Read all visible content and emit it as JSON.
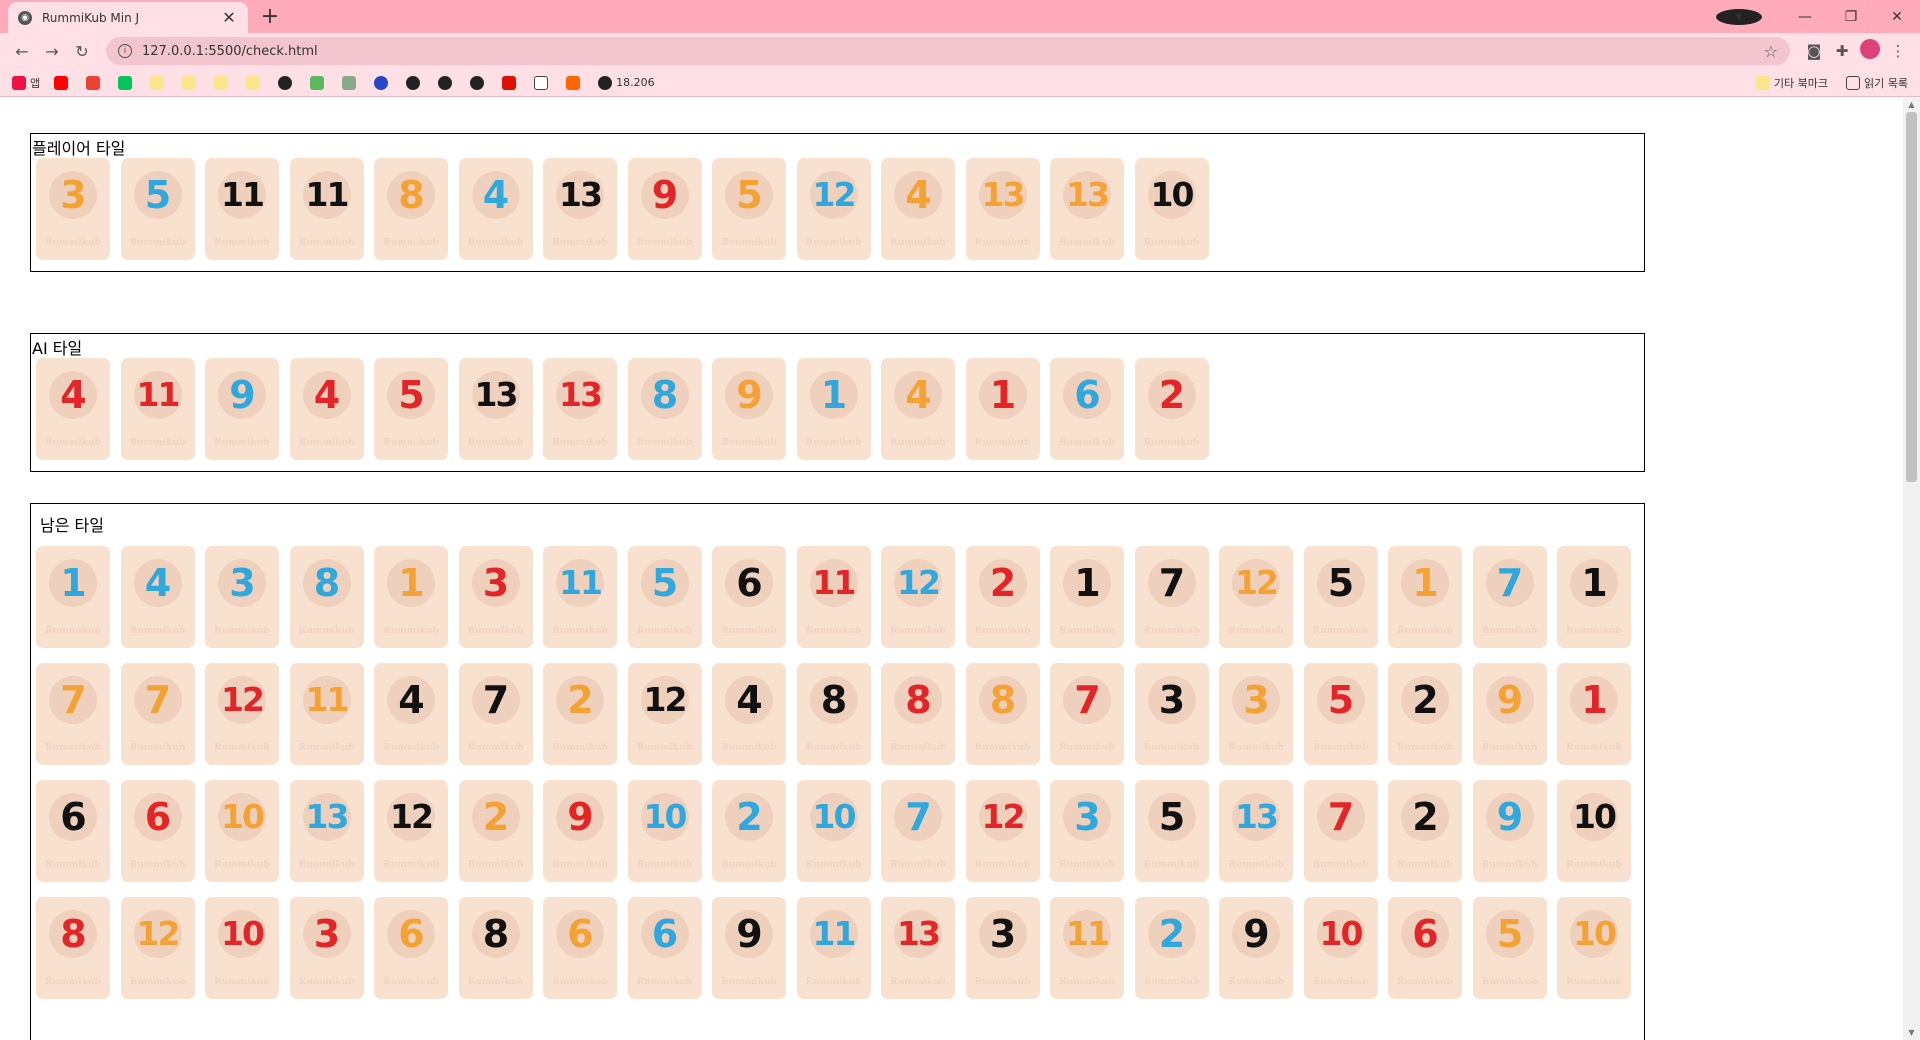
{
  "browser": {
    "tab_title": "RummiKub Min J",
    "url": "127.0.0.1:5500/check.html",
    "bookmarks": [
      "앱",
      "",
      "",
      "",
      "",
      "",
      "",
      "",
      "",
      "",
      "",
      "",
      "",
      "",
      "",
      "",
      "",
      "",
      "18.206"
    ],
    "bookmark_folder": "기타 북마크",
    "reading_list": "읽기 목록"
  },
  "panels": {
    "player": {
      "title": "플레이어 타일",
      "tiles": [
        {
          "n": "3",
          "c": "orange"
        },
        {
          "n": "5",
          "c": "blue"
        },
        {
          "n": "11",
          "c": "black"
        },
        {
          "n": "11",
          "c": "black"
        },
        {
          "n": "8",
          "c": "orange"
        },
        {
          "n": "4",
          "c": "blue"
        },
        {
          "n": "13",
          "c": "black"
        },
        {
          "n": "9",
          "c": "red"
        },
        {
          "n": "5",
          "c": "orange"
        },
        {
          "n": "12",
          "c": "blue"
        },
        {
          "n": "4",
          "c": "orange"
        },
        {
          "n": "13",
          "c": "orange"
        },
        {
          "n": "13",
          "c": "orange"
        },
        {
          "n": "10",
          "c": "black"
        }
      ]
    },
    "ai": {
      "title": "AI 타일",
      "tiles": [
        {
          "n": "4",
          "c": "red"
        },
        {
          "n": "11",
          "c": "red"
        },
        {
          "n": "9",
          "c": "blue"
        },
        {
          "n": "4",
          "c": "red"
        },
        {
          "n": "5",
          "c": "red"
        },
        {
          "n": "13",
          "c": "black"
        },
        {
          "n": "13",
          "c": "red"
        },
        {
          "n": "8",
          "c": "blue"
        },
        {
          "n": "9",
          "c": "orange"
        },
        {
          "n": "1",
          "c": "blue"
        },
        {
          "n": "4",
          "c": "orange"
        },
        {
          "n": "1",
          "c": "red"
        },
        {
          "n": "6",
          "c": "blue"
        },
        {
          "n": "2",
          "c": "red"
        }
      ]
    },
    "remaining": {
      "title": "남은 타일",
      "rows": [
        [
          {
            "n": "1",
            "c": "blue"
          },
          {
            "n": "4",
            "c": "blue"
          },
          {
            "n": "3",
            "c": "blue"
          },
          {
            "n": "8",
            "c": "blue"
          },
          {
            "n": "1",
            "c": "orange"
          },
          {
            "n": "3",
            "c": "red"
          },
          {
            "n": "11",
            "c": "blue"
          },
          {
            "n": "5",
            "c": "blue"
          },
          {
            "n": "6",
            "c": "black"
          },
          {
            "n": "11",
            "c": "red"
          },
          {
            "n": "12",
            "c": "blue"
          },
          {
            "n": "2",
            "c": "red"
          },
          {
            "n": "1",
            "c": "black"
          },
          {
            "n": "7",
            "c": "black"
          },
          {
            "n": "12",
            "c": "orange"
          },
          {
            "n": "5",
            "c": "black"
          },
          {
            "n": "1",
            "c": "orange"
          },
          {
            "n": "7",
            "c": "blue"
          },
          {
            "n": "1",
            "c": "black"
          }
        ],
        [
          {
            "n": "7",
            "c": "orange"
          },
          {
            "n": "7",
            "c": "orange"
          },
          {
            "n": "12",
            "c": "red"
          },
          {
            "n": "11",
            "c": "orange"
          },
          {
            "n": "4",
            "c": "black"
          },
          {
            "n": "7",
            "c": "black"
          },
          {
            "n": "2",
            "c": "orange"
          },
          {
            "n": "12",
            "c": "black"
          },
          {
            "n": "4",
            "c": "black"
          },
          {
            "n": "8",
            "c": "black"
          },
          {
            "n": "8",
            "c": "red"
          },
          {
            "n": "8",
            "c": "orange"
          },
          {
            "n": "7",
            "c": "red"
          },
          {
            "n": "3",
            "c": "black"
          },
          {
            "n": "3",
            "c": "orange"
          },
          {
            "n": "5",
            "c": "red"
          },
          {
            "n": "2",
            "c": "black"
          },
          {
            "n": "9",
            "c": "orange"
          },
          {
            "n": "1",
            "c": "red"
          }
        ],
        [
          {
            "n": "6",
            "c": "black"
          },
          {
            "n": "6",
            "c": "red"
          },
          {
            "n": "10",
            "c": "orange"
          },
          {
            "n": "13",
            "c": "blue"
          },
          {
            "n": "12",
            "c": "black"
          },
          {
            "n": "2",
            "c": "orange"
          },
          {
            "n": "9",
            "c": "red"
          },
          {
            "n": "10",
            "c": "blue"
          },
          {
            "n": "2",
            "c": "blue"
          },
          {
            "n": "10",
            "c": "blue"
          },
          {
            "n": "7",
            "c": "blue"
          },
          {
            "n": "12",
            "c": "red"
          },
          {
            "n": "3",
            "c": "blue"
          },
          {
            "n": "5",
            "c": "black"
          },
          {
            "n": "13",
            "c": "blue"
          },
          {
            "n": "7",
            "c": "red"
          },
          {
            "n": "2",
            "c": "black"
          },
          {
            "n": "9",
            "c": "blue"
          },
          {
            "n": "10",
            "c": "black"
          }
        ],
        [
          {
            "n": "8",
            "c": "red"
          },
          {
            "n": "12",
            "c": "orange"
          },
          {
            "n": "10",
            "c": "red"
          },
          {
            "n": "3",
            "c": "red"
          },
          {
            "n": "6",
            "c": "orange"
          },
          {
            "n": "8",
            "c": "black"
          },
          {
            "n": "6",
            "c": "orange"
          },
          {
            "n": "6",
            "c": "blue"
          },
          {
            "n": "9",
            "c": "black"
          },
          {
            "n": "11",
            "c": "blue"
          },
          {
            "n": "13",
            "c": "red"
          },
          {
            "n": "3",
            "c": "black"
          },
          {
            "n": "11",
            "c": "orange"
          },
          {
            "n": "2",
            "c": "blue"
          },
          {
            "n": "9",
            "c": "black"
          },
          {
            "n": "10",
            "c": "red"
          },
          {
            "n": "6",
            "c": "red"
          },
          {
            "n": "5",
            "c": "orange"
          },
          {
            "n": "10",
            "c": "orange"
          }
        ]
      ]
    }
  },
  "tile_brand": "Rummikub",
  "colors": {
    "orange": "#f4a233",
    "blue": "#30a7dd",
    "black": "#111111",
    "red": "#e42527",
    "tile_bg": "#f9e1cf"
  }
}
